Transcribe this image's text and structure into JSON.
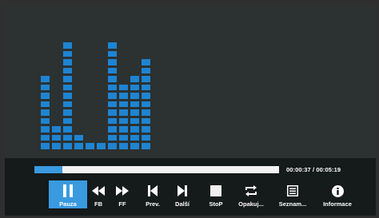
{
  "player": {
    "time_display": "00:00:37 / 00:05:19",
    "progress_fraction": 0.116,
    "buttons": [
      {
        "label": "Pauza",
        "icon": "pause-icon",
        "active": true
      },
      {
        "label": "FB",
        "icon": "fast-backward-icon",
        "active": false
      },
      {
        "label": "FF",
        "icon": "fast-forward-icon",
        "active": false
      },
      {
        "label": "Prev.",
        "icon": "skip-previous-icon",
        "active": false
      },
      {
        "label": "Další",
        "icon": "skip-next-icon",
        "active": false
      },
      {
        "label": "StoP",
        "icon": "stop-icon",
        "active": false
      },
      {
        "label": "Opakuj...",
        "icon": "repeat-icon",
        "active": false
      },
      {
        "label": "Seznam...",
        "icon": "playlist-icon",
        "active": false
      },
      {
        "label": "Informace",
        "icon": "info-icon",
        "active": false
      }
    ]
  },
  "equalizer": {
    "color": "#1e84d2",
    "bar_levels": [
      9,
      3,
      13,
      2,
      1,
      1,
      13,
      8,
      9,
      11
    ]
  },
  "colors": {
    "background": "#2c3131",
    "controls_background": "#151a1a",
    "accent": "#3a9ae0"
  }
}
